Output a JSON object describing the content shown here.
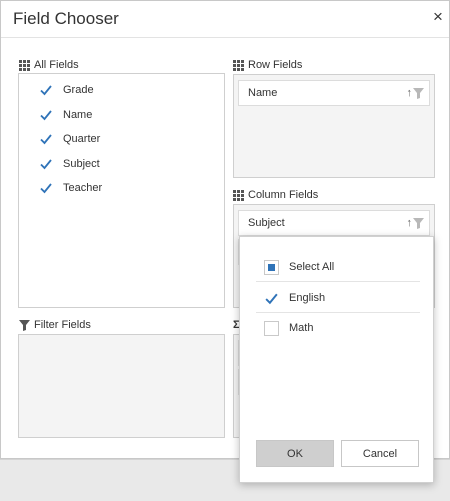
{
  "dialog": {
    "title": "Field Chooser",
    "close_label": "×"
  },
  "sections": {
    "all_fields": "All Fields",
    "row_fields": "Row Fields",
    "column_fields": "Column Fields",
    "filter_fields": "Filter Fields",
    "values_partial_glyph": "Σ"
  },
  "all_fields": [
    {
      "label": "Grade",
      "checked": true
    },
    {
      "label": "Name",
      "checked": true
    },
    {
      "label": "Quarter",
      "checked": true
    },
    {
      "label": "Subject",
      "checked": true
    },
    {
      "label": "Teacher",
      "checked": true
    }
  ],
  "row_fields": [
    {
      "label": "Name"
    }
  ],
  "column_fields": [
    {
      "label": "Subject"
    }
  ],
  "filter_popup": {
    "items": [
      {
        "label": "Select All",
        "state": "partial"
      },
      {
        "label": "English",
        "state": "checked"
      },
      {
        "label": "Math",
        "state": "unchecked"
      }
    ],
    "ok_label": "OK",
    "cancel_label": "Cancel"
  },
  "icons": {
    "sort": "sort-arrow-icon",
    "filter": "filter-icon",
    "grid": "grid-icon",
    "check": "checkmark-icon"
  },
  "colors": {
    "accent": "#2f73b8",
    "checkmark": "#2f73b8",
    "panel_bg": "#f4f4f4",
    "ok_bg": "#cfcfcf"
  }
}
